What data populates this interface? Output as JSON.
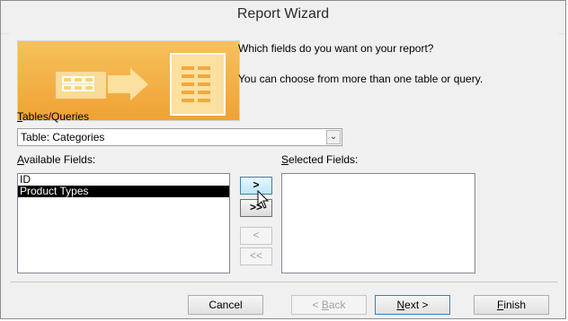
{
  "window": {
    "title": "Report Wizard"
  },
  "prompts": {
    "line1": "Which fields do you want on your report?",
    "line2": "You can choose from more than one table or query."
  },
  "tables": {
    "label_u": "T",
    "label_rest": "ables/Queries",
    "selected": "Table: Categories"
  },
  "available": {
    "label_u": "A",
    "label_rest": "vailable Fields:",
    "items": [
      "ID",
      "Product Types"
    ],
    "selected_index": 1
  },
  "selected_fields": {
    "label_u": "S",
    "label_rest": "elected Fields:",
    "items": []
  },
  "move_buttons": {
    "add_one": ">",
    "add_all": ">>",
    "remove_one": "<",
    "remove_all": "<<"
  },
  "footer": {
    "cancel": "Cancel",
    "back": "< Back",
    "back_underline": "B",
    "next": "Next >",
    "next_underline": "N",
    "finish": "Finish",
    "finish_underline": "F"
  },
  "colors": {
    "illustration": "#f0a233",
    "selection": "#000000"
  },
  "icons": {
    "illustration": "table-to-report-icon",
    "combo": "chevron-down-icon",
    "pointer": "mouse-pointer-icon"
  }
}
